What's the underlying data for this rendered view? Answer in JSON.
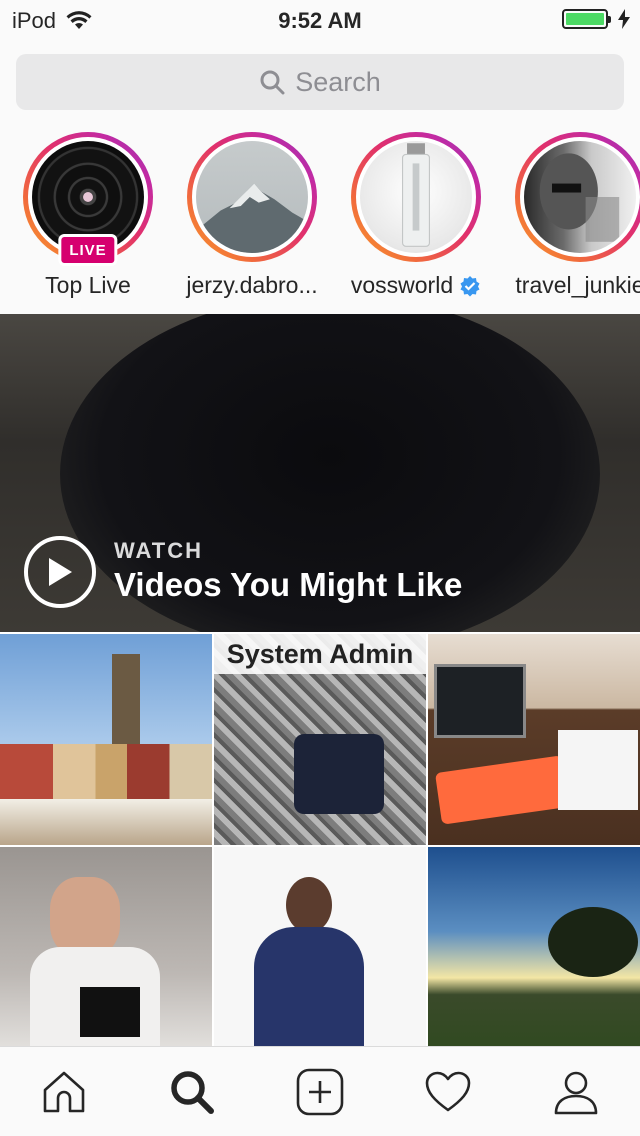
{
  "status_bar": {
    "device": "iPod",
    "time": "9:52 AM",
    "battery_level": 1.0
  },
  "search": {
    "placeholder": "Search"
  },
  "stories": [
    {
      "name": "Top Live",
      "live": true,
      "live_label": "LIVE"
    },
    {
      "name": "jerzy.dabro..."
    },
    {
      "name": "vossworld",
      "verified": true
    },
    {
      "name": "travel_junkie"
    }
  ],
  "video": {
    "kicker": "WATCH",
    "title": "Videos You Might Like"
  },
  "grid": {
    "tile2_caption": "System Admin"
  },
  "tabs": [
    "home-icon",
    "search-icon",
    "add-icon",
    "heart-icon",
    "profile-icon"
  ],
  "colors": {
    "live_badge": "#d6006f",
    "verified": "#3897f0",
    "battery": "#4cd964"
  }
}
